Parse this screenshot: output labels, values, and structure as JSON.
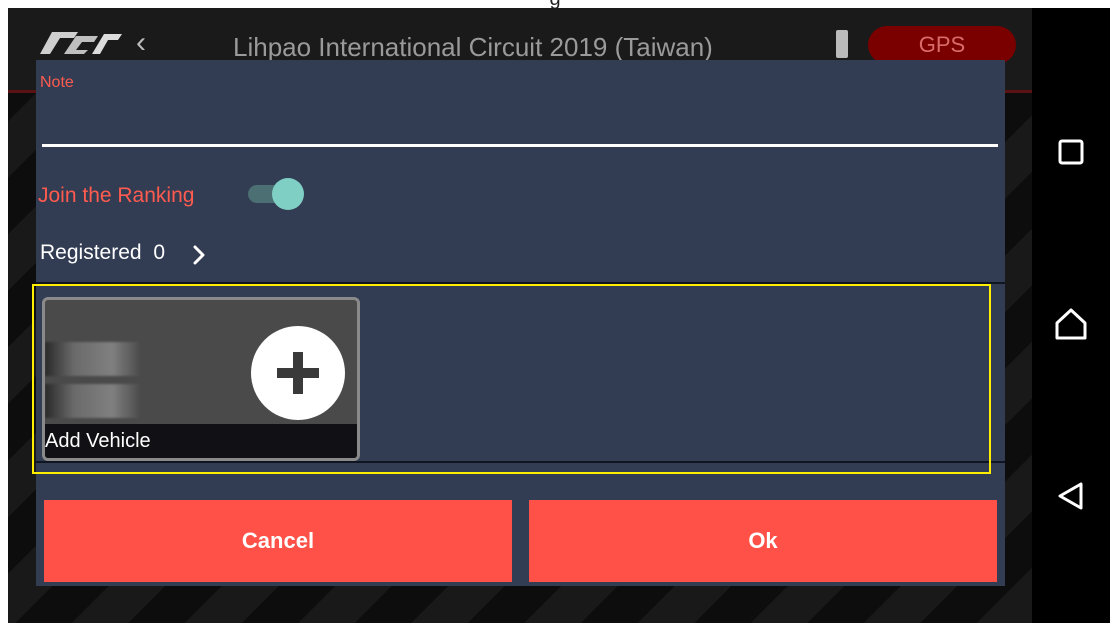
{
  "app": {
    "title": "Lihpao International Circuit 2019 (Taiwan)",
    "gps_label": "GPS",
    "top_strip_text": "g"
  },
  "dialog": {
    "note_label": "Note",
    "note_value": "",
    "join_ranking_label": "Join the Ranking",
    "join_ranking_on": true,
    "registered_label": "Registered",
    "registered_count": "0",
    "add_vehicle_label": "Add Vehicle",
    "cancel_label": "Cancel",
    "ok_label": "Ok"
  },
  "colors": {
    "accent": "#ff5148",
    "label_red": "#ff5b4f",
    "dialog_bg": "#323c52",
    "toggle_thumb": "#7fcfc5",
    "highlight": "#ffee00"
  },
  "icons": [
    "back-chevron-icon",
    "battery-icon",
    "square-nav-icon",
    "home-nav-icon",
    "back-nav-icon",
    "chevron-right-icon",
    "plus-icon",
    "logo"
  ]
}
